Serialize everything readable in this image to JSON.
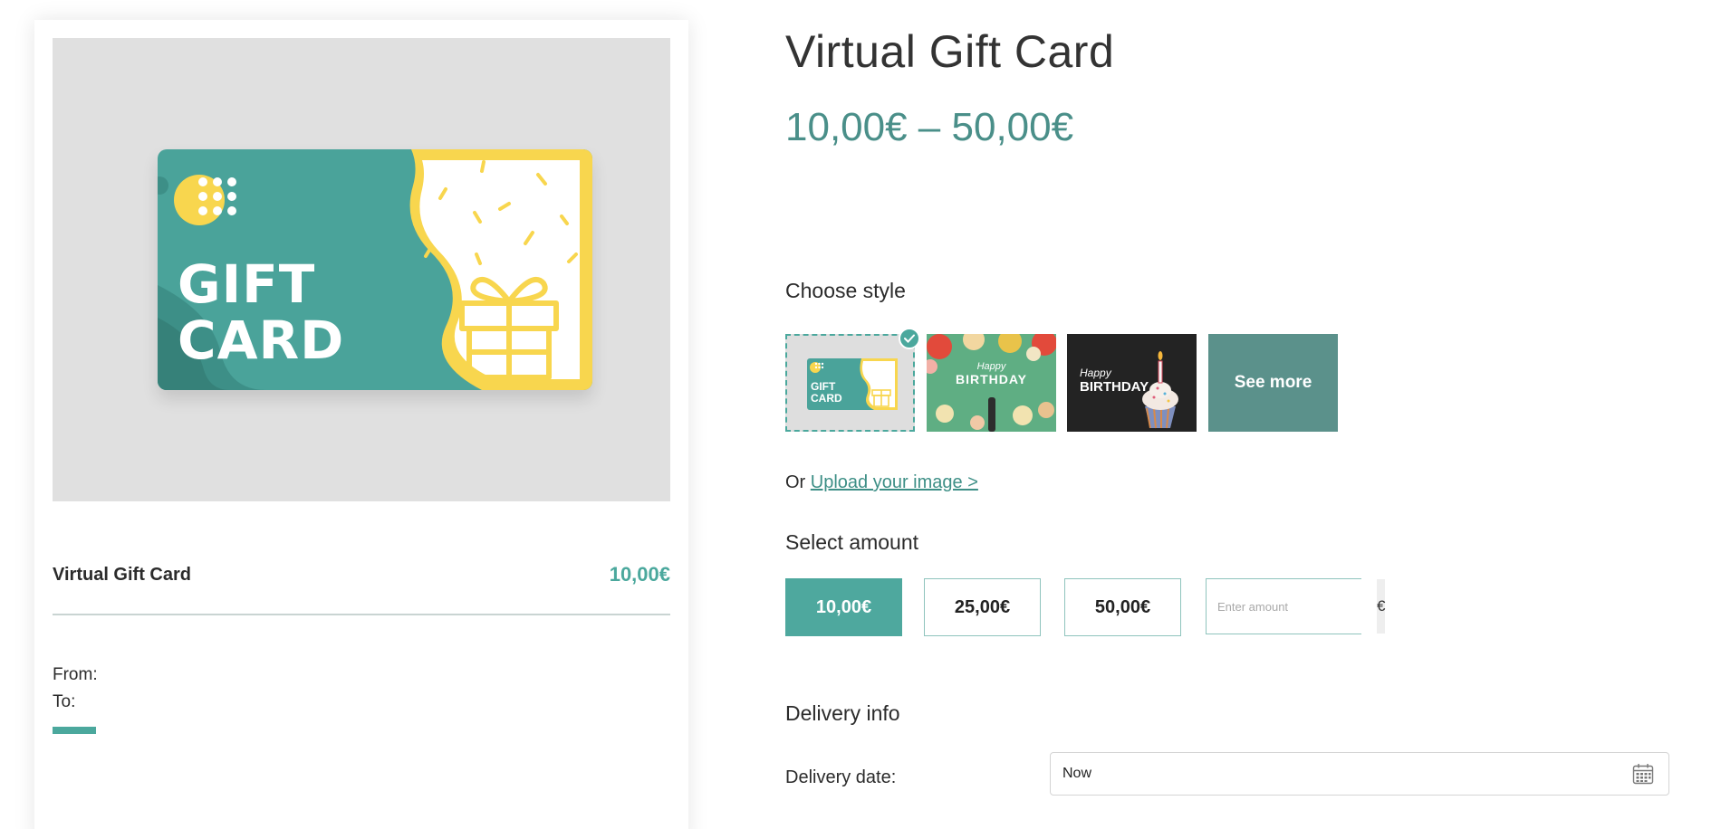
{
  "product": {
    "title": "Virtual Gift Card",
    "price_range": "10,00€ – 50,00€"
  },
  "preview": {
    "card_line1": "GIFT",
    "card_line2": "CARD",
    "name": "Virtual Gift Card",
    "price": "10,00€",
    "from_label": "From:",
    "to_label": "To:"
  },
  "style_section": {
    "title": "Choose style",
    "thumbnails": [
      {
        "name": "gift-card",
        "line1": "GIFT",
        "line2": "CARD",
        "selected": true
      },
      {
        "name": "happy-birthday-balloons",
        "line1": "Happy",
        "line2": "BIRTHDAY",
        "selected": false
      },
      {
        "name": "happy-birthday-cupcake",
        "line1": "Happy",
        "line2": "BIRTHDAY",
        "selected": false
      }
    ],
    "see_more_label": "See more",
    "upload_prefix": "Or",
    "upload_link": "Upload your image >"
  },
  "amount_section": {
    "title": "Select amount",
    "options": [
      "10,00€",
      "25,00€",
      "50,00€"
    ],
    "selected_index": 0,
    "custom_placeholder": "Enter amount",
    "currency_symbol": "€"
  },
  "delivery_section": {
    "title": "Delivery info",
    "date_label": "Delivery date:",
    "date_value": "Now"
  },
  "colors": {
    "accent": "#4ba89d",
    "price_text": "#4a8f89",
    "card_yellow": "#f8d64e"
  },
  "icons": [
    "check-icon",
    "calendar-icon"
  ]
}
